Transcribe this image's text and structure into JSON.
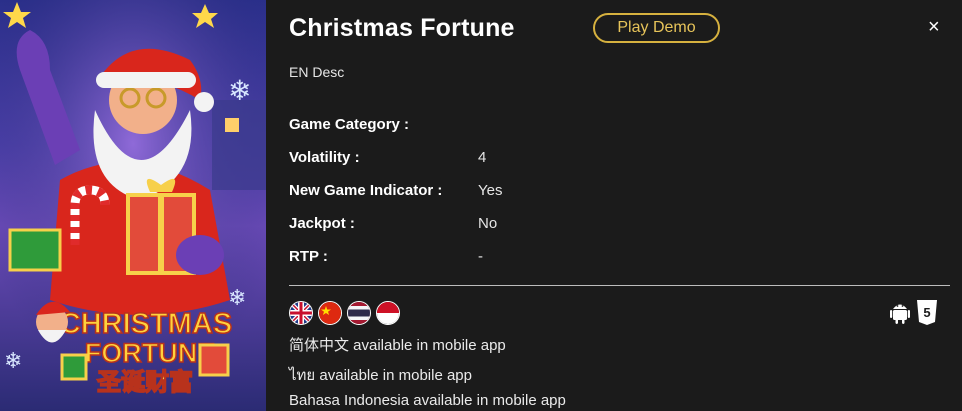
{
  "game": {
    "title": "Christmas Fortune",
    "play_demo_label": "Play Demo",
    "close_glyph": "×",
    "description": "EN Desc",
    "logo_text_line1": "CHRISTMAS",
    "logo_text_line2": "FORTUNE",
    "logo_text_cn": "圣诞财富"
  },
  "info_rows": [
    {
      "label": "Game Category :",
      "value": ""
    },
    {
      "label": "Volatility :",
      "value": "4"
    },
    {
      "label": "New Game Indicator :",
      "value": "Yes"
    },
    {
      "label": "Jackpot :",
      "value": "No"
    },
    {
      "label": "RTP :",
      "value": "-"
    }
  ],
  "languages": [
    "english-flag-icon",
    "china-flag-icon",
    "thailand-flag-icon",
    "indonesia-flag-icon"
  ],
  "platforms": [
    "android-icon",
    "html5-icon"
  ],
  "availability": [
    "简体中文 available in mobile app",
    "ไทย available in mobile app",
    "Bahasa Indonesia available in mobile app"
  ],
  "colors": {
    "background": "#1b1b1b",
    "accent": "#d6b13f",
    "text": "#ffffff"
  }
}
